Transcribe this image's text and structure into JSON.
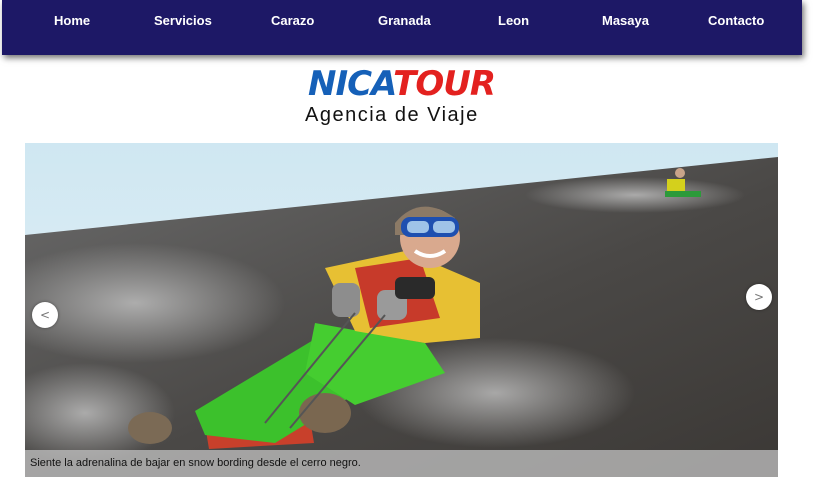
{
  "nav": {
    "items": [
      {
        "label": "Home"
      },
      {
        "label": "Servicios"
      },
      {
        "label": "Carazo"
      },
      {
        "label": "Granada"
      },
      {
        "label": "Leon"
      },
      {
        "label": "Masaya"
      },
      {
        "label": "Contacto"
      }
    ]
  },
  "logo": {
    "word_part1": "NICA",
    "word_part2": "TOUR",
    "tagline": "Agencia de Viaje",
    "colors": {
      "part1": "#1560b8",
      "part2": "#e3211f"
    }
  },
  "slider": {
    "prev_label": "<",
    "next_label": ">",
    "caption": "Siente la adrenalina de bajar en snow bording desde el cerro negro.",
    "photo_icon": "volcano-boarding-photo"
  },
  "colors": {
    "navbar": "#1d1866",
    "nav_text": "#ffffff"
  }
}
